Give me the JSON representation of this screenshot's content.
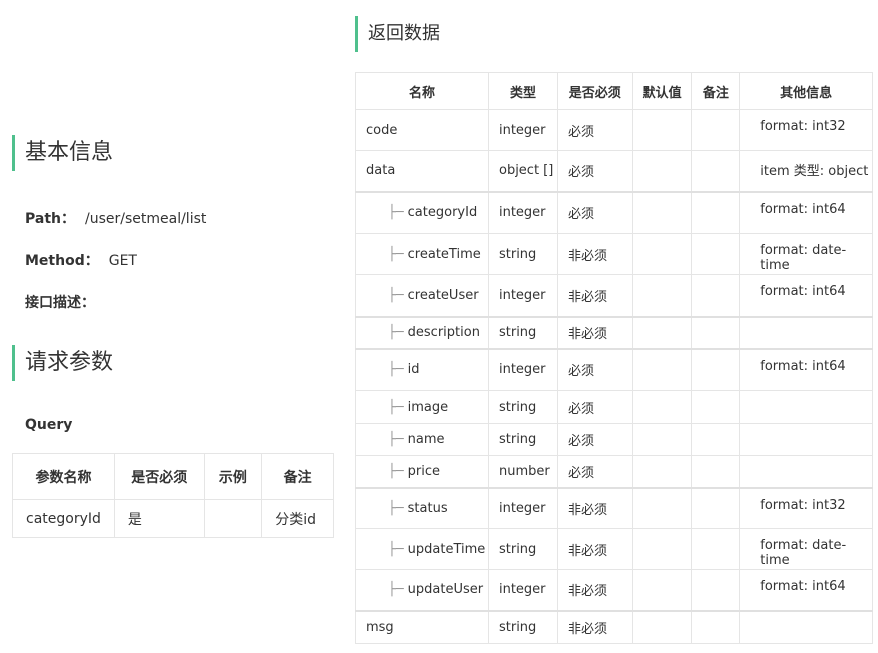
{
  "basic_info": {
    "title": "基本信息",
    "path_label": "Path：",
    "path_value": "/user/setmeal/list",
    "method_label": "Method：",
    "method_value": "GET",
    "desc_label": "接口描述："
  },
  "request": {
    "title": "请求参数",
    "query_label": "Query",
    "headers": [
      "参数名称",
      "是否必须",
      "示例",
      "备注"
    ],
    "rows": [
      {
        "name": "categoryId",
        "required": "是",
        "example": "",
        "note": "分类id"
      }
    ]
  },
  "response": {
    "title": "返回数据",
    "headers": [
      "名称",
      "类型",
      "是否必须",
      "默认值",
      "备注",
      "其他信息"
    ],
    "rows": [
      {
        "name": "code",
        "child": false,
        "type": "integer",
        "required": "必须",
        "default": "",
        "note": "",
        "other": "format: int32"
      },
      {
        "name": "data",
        "child": false,
        "type": "object []",
        "required": "必须",
        "default": "",
        "note": "",
        "other": "item 类型: object"
      },
      {
        "name": "categoryId",
        "child": true,
        "type": "integer",
        "required": "必须",
        "default": "",
        "note": "",
        "other": "format: int64"
      },
      {
        "name": "createTime",
        "child": true,
        "type": "string",
        "required": "非必须",
        "default": "",
        "note": "",
        "other": "format: date-time"
      },
      {
        "name": "createUser",
        "child": true,
        "type": "integer",
        "required": "非必须",
        "default": "",
        "note": "",
        "other": "format: int64"
      },
      {
        "name": "description",
        "child": true,
        "type": "string",
        "required": "非必须",
        "default": "",
        "note": "",
        "other": ""
      },
      {
        "name": "id",
        "child": true,
        "type": "integer",
        "required": "必须",
        "default": "",
        "note": "",
        "other": "format: int64"
      },
      {
        "name": "image",
        "child": true,
        "type": "string",
        "required": "必须",
        "default": "",
        "note": "",
        "other": ""
      },
      {
        "name": "name",
        "child": true,
        "type": "string",
        "required": "必须",
        "default": "",
        "note": "",
        "other": ""
      },
      {
        "name": "price",
        "child": true,
        "type": "number",
        "required": "必须",
        "default": "",
        "note": "",
        "other": ""
      },
      {
        "name": "status",
        "child": true,
        "type": "integer",
        "required": "非必须",
        "default": "",
        "note": "",
        "other": "format: int32"
      },
      {
        "name": "updateTime",
        "child": true,
        "type": "string",
        "required": "非必须",
        "default": "",
        "note": "",
        "other": "format: date-time"
      },
      {
        "name": "updateUser",
        "child": true,
        "type": "integer",
        "required": "非必须",
        "default": "",
        "note": "",
        "other": "format: int64"
      },
      {
        "name": "msg",
        "child": false,
        "type": "string",
        "required": "非必须",
        "default": "",
        "note": "",
        "other": ""
      }
    ],
    "tree_prefix": "├─"
  },
  "colors": {
    "accent": "#4fc08d",
    "border": "#e5e5e5"
  }
}
